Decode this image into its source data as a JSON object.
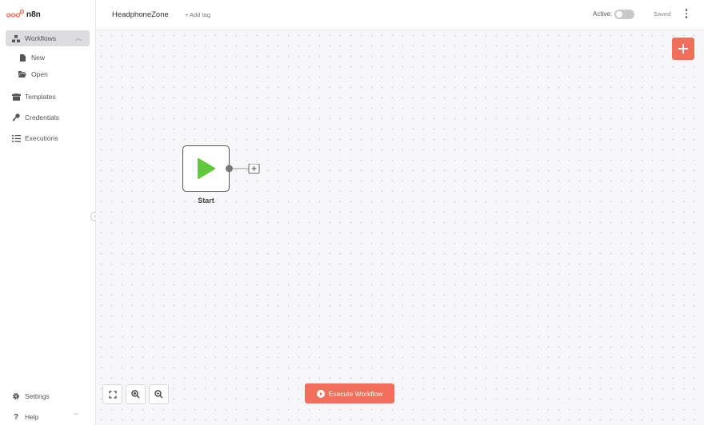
{
  "brand": {
    "name": "n8n",
    "color": "#ef6f5a"
  },
  "sidebar": {
    "workflows": {
      "label": "Workflows",
      "icon": "network-icon"
    },
    "sub_items": [
      {
        "label": "New",
        "icon": "file-icon"
      },
      {
        "label": "Open",
        "icon": "folder-open-icon"
      }
    ],
    "items": [
      {
        "label": "Templates",
        "icon": "box-open-icon"
      },
      {
        "label": "Credentials",
        "icon": "key-icon"
      },
      {
        "label": "Executions",
        "icon": "tasks-icon"
      }
    ],
    "footer": [
      {
        "label": "Settings",
        "icon": "gear-icon"
      },
      {
        "label": "Help",
        "icon": "question-icon"
      }
    ]
  },
  "header": {
    "workflow_name": "HeadphoneZone",
    "add_tag": "+ Add tag",
    "active_label": "Active:",
    "active": false,
    "saved_label": "Saved"
  },
  "canvas": {
    "start_node": {
      "label": "Start",
      "icon": "play-icon",
      "icon_color": "#5fc83b"
    },
    "execute_button": "Execute Workflow"
  }
}
